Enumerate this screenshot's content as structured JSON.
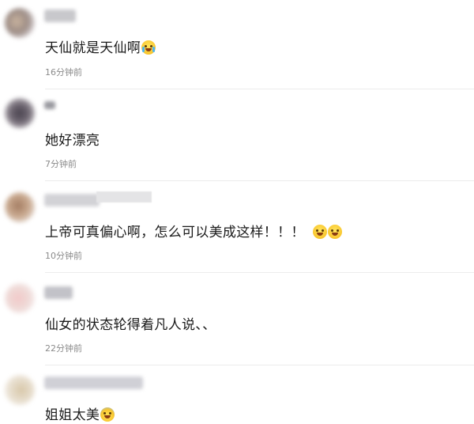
{
  "comments": [
    {
      "text": "天仙就是天仙啊",
      "emoji": "crying-laughing-emoji",
      "time": "16分钟前"
    },
    {
      "text": "她好漂亮",
      "emoji": "",
      "time": "7分钟前"
    },
    {
      "text": "上帝可真偏心啊，怎么可以美成这样！！！",
      "emoji": "laughing-emoji",
      "time": "10分钟前"
    },
    {
      "text": "仙女的状态轮得着凡人说、、",
      "emoji": "",
      "time": "22分钟前"
    },
    {
      "text": "姐姐太美",
      "emoji": "scared-emoji",
      "time": ""
    }
  ],
  "colors": {
    "text": "#1a1a1a",
    "timestamp": "#8a8a8a",
    "divider": "#ececec",
    "emoji": "#f9c62e"
  }
}
